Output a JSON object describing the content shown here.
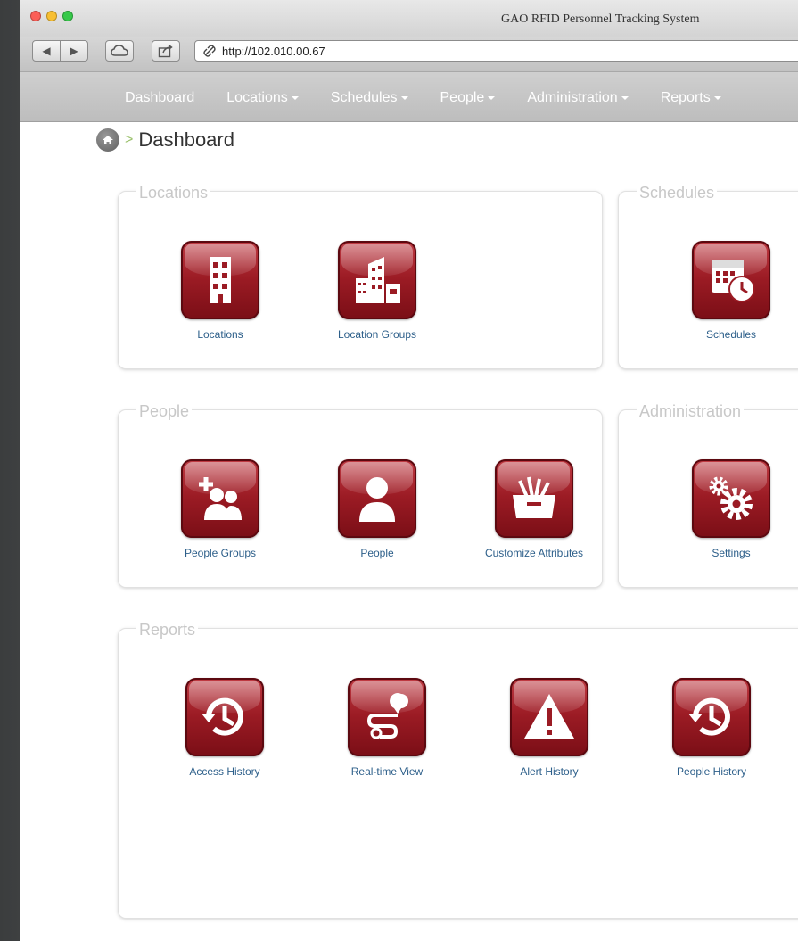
{
  "window": {
    "title": "GAO RFID Personnel Tracking System"
  },
  "toolbar": {
    "url": "http://102.010.00.67"
  },
  "nav": {
    "items": [
      {
        "label": "Dashboard",
        "dropdown": false
      },
      {
        "label": "Locations",
        "dropdown": true
      },
      {
        "label": "Schedules",
        "dropdown": true
      },
      {
        "label": "People",
        "dropdown": true
      },
      {
        "label": "Administration",
        "dropdown": true
      },
      {
        "label": "Reports",
        "dropdown": true
      }
    ]
  },
  "breadcrumb": {
    "separator": ">",
    "title": "Dashboard"
  },
  "panels": {
    "locations": {
      "legend": "Locations",
      "tiles": [
        {
          "label": "Locations",
          "icon": "building-icon"
        },
        {
          "label": "Location Groups",
          "icon": "buildings-group-icon"
        }
      ]
    },
    "schedules": {
      "legend": "Schedules",
      "tiles": [
        {
          "label": "Schedules",
          "icon": "calendar-clock-icon"
        }
      ]
    },
    "people": {
      "legend": "People",
      "tiles": [
        {
          "label": "People Groups",
          "icon": "people-add-icon"
        },
        {
          "label": "People",
          "icon": "person-icon"
        },
        {
          "label": "Customize Attributes",
          "icon": "toolbox-icon"
        }
      ]
    },
    "administration": {
      "legend": "Administration",
      "tiles": [
        {
          "label": "Settings",
          "icon": "gears-icon"
        }
      ]
    },
    "reports": {
      "legend": "Reports",
      "tiles": [
        {
          "label": "Access History",
          "icon": "history-icon"
        },
        {
          "label": "Real-time View",
          "icon": "route-map-icon"
        },
        {
          "label": "Alert History",
          "icon": "warning-icon"
        },
        {
          "label": "People History",
          "icon": "history-icon"
        }
      ]
    }
  },
  "colors": {
    "tile_red": "#9b1b24",
    "link_blue": "#2d5f8a",
    "legend_gray": "#c8c8c8"
  }
}
